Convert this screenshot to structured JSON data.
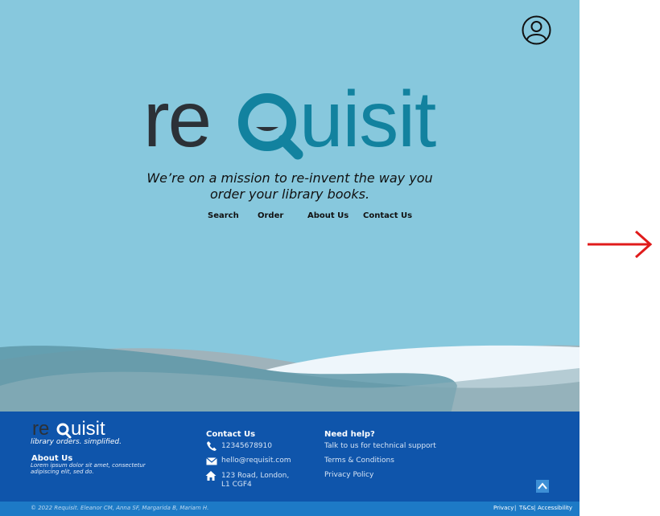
{
  "brand": {
    "logo_re": "re",
    "logo_q": "q",
    "logo_uisit": "uisit",
    "tagline": "We’re on a mission to re-invent the way you order your library books.",
    "colors": {
      "dark": "#2c3137",
      "teal": "#12829f",
      "footer": "#0f55ab",
      "background": "#87c8dd"
    }
  },
  "header": {
    "profile_icon": "user-circle-icon"
  },
  "nav": [
    {
      "label": "Search"
    },
    {
      "label": "Order"
    },
    {
      "label": "About Us"
    },
    {
      "label": "Contact Us"
    }
  ],
  "footer": {
    "logo_re": "re",
    "logo_q": "q",
    "logo_uisit": "uisit",
    "slogan": "library orders. simplified.",
    "about_title": "About Us",
    "about_text": "Lorem ipsum dolor sit amet, consectetur adipiscing elit, sed do.",
    "contact_title": "Contact Us",
    "phone": "12345678910",
    "email": "hello@requisit.com",
    "address_line1": "123 Road, London,",
    "address_line2": "L1 CGF4",
    "help_title": "Need help?",
    "help_links": [
      "Talk to us for technical support",
      "Terms & Conditions",
      "Privacy Policy"
    ],
    "copyright": "© 2022 Requisit. Eleanor CM, Anna SF, Margarida B, Mariam H.",
    "legal_links": [
      "Privacy",
      "|",
      "T&Cs",
      "|",
      "Accessibility"
    ]
  }
}
